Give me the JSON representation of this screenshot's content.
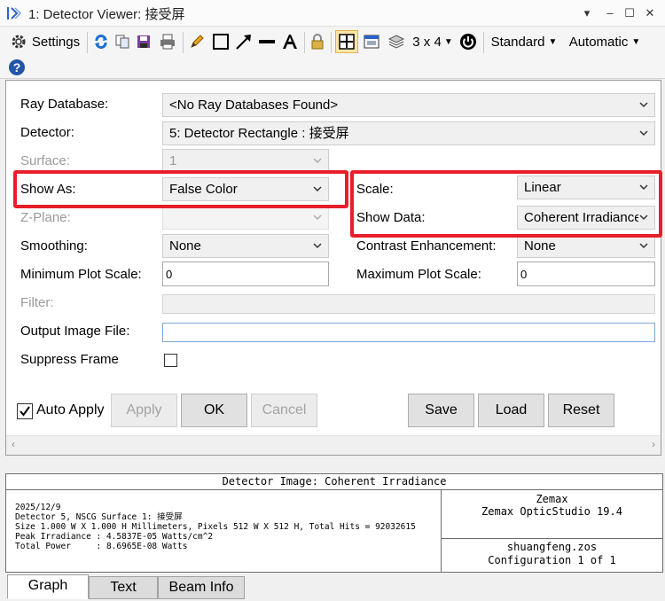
{
  "window": {
    "title": "1: Detector Viewer: 接受屏"
  },
  "toolbar": {
    "settings_label": "Settings",
    "layout_label": "3 x 4",
    "standard_label": "Standard",
    "automatic_label": "Automatic"
  },
  "form": {
    "ray_database": {
      "label": "Ray Database:",
      "value": "<No Ray Databases Found>"
    },
    "detector": {
      "label": "Detector:",
      "value": "5: Detector Rectangle : 接受屏"
    },
    "surface": {
      "label": "Surface:",
      "value": "1"
    },
    "show_as": {
      "label": "Show As:",
      "value": "False Color"
    },
    "z_plane": {
      "label": "Z-Plane:",
      "value": ""
    },
    "smoothing": {
      "label": "Smoothing:",
      "value": "None"
    },
    "min_plot_scale": {
      "label": "Minimum Plot Scale:",
      "value": "0"
    },
    "filter": {
      "label": "Filter:",
      "value": ""
    },
    "output_image_file": {
      "label": "Output Image File:",
      "value": ""
    },
    "suppress_frame": {
      "label": "Suppress Frame"
    },
    "scale": {
      "label": "Scale:",
      "value": "Linear"
    },
    "show_data": {
      "label": "Show Data:",
      "value": "Coherent Irradiance"
    },
    "contrast": {
      "label": "Contrast Enhancement:",
      "value": "None"
    },
    "max_plot_scale": {
      "label": "Maximum Plot Scale:",
      "value": "0"
    }
  },
  "buttons": {
    "auto_apply": "Auto Apply",
    "apply": "Apply",
    "ok": "OK",
    "cancel": "Cancel",
    "save": "Save",
    "load": "Load",
    "reset": "Reset"
  },
  "report": {
    "title": "Detector Image: Coherent Irradiance",
    "lines": [
      "2025/12/9",
      "Detector 5, NSCG Surface 1: 接受屏",
      "Size 1.000 W X 1.000 H Millimeters, Pixels 512 W X 512 H, Total Hits = 92032615",
      "Peak Irradiance : 4.5837E-05 Watts/cm^2",
      "Total Power     : 8.6965E-08 Watts"
    ],
    "vendor": "Zemax",
    "product": "Zemax OpticStudio 19.4",
    "file": "shuangfeng.zos",
    "configuration": "Configuration 1 of 1"
  },
  "tabs": [
    {
      "label": "Graph"
    },
    {
      "label": "Text"
    },
    {
      "label": "Beam Info"
    }
  ]
}
